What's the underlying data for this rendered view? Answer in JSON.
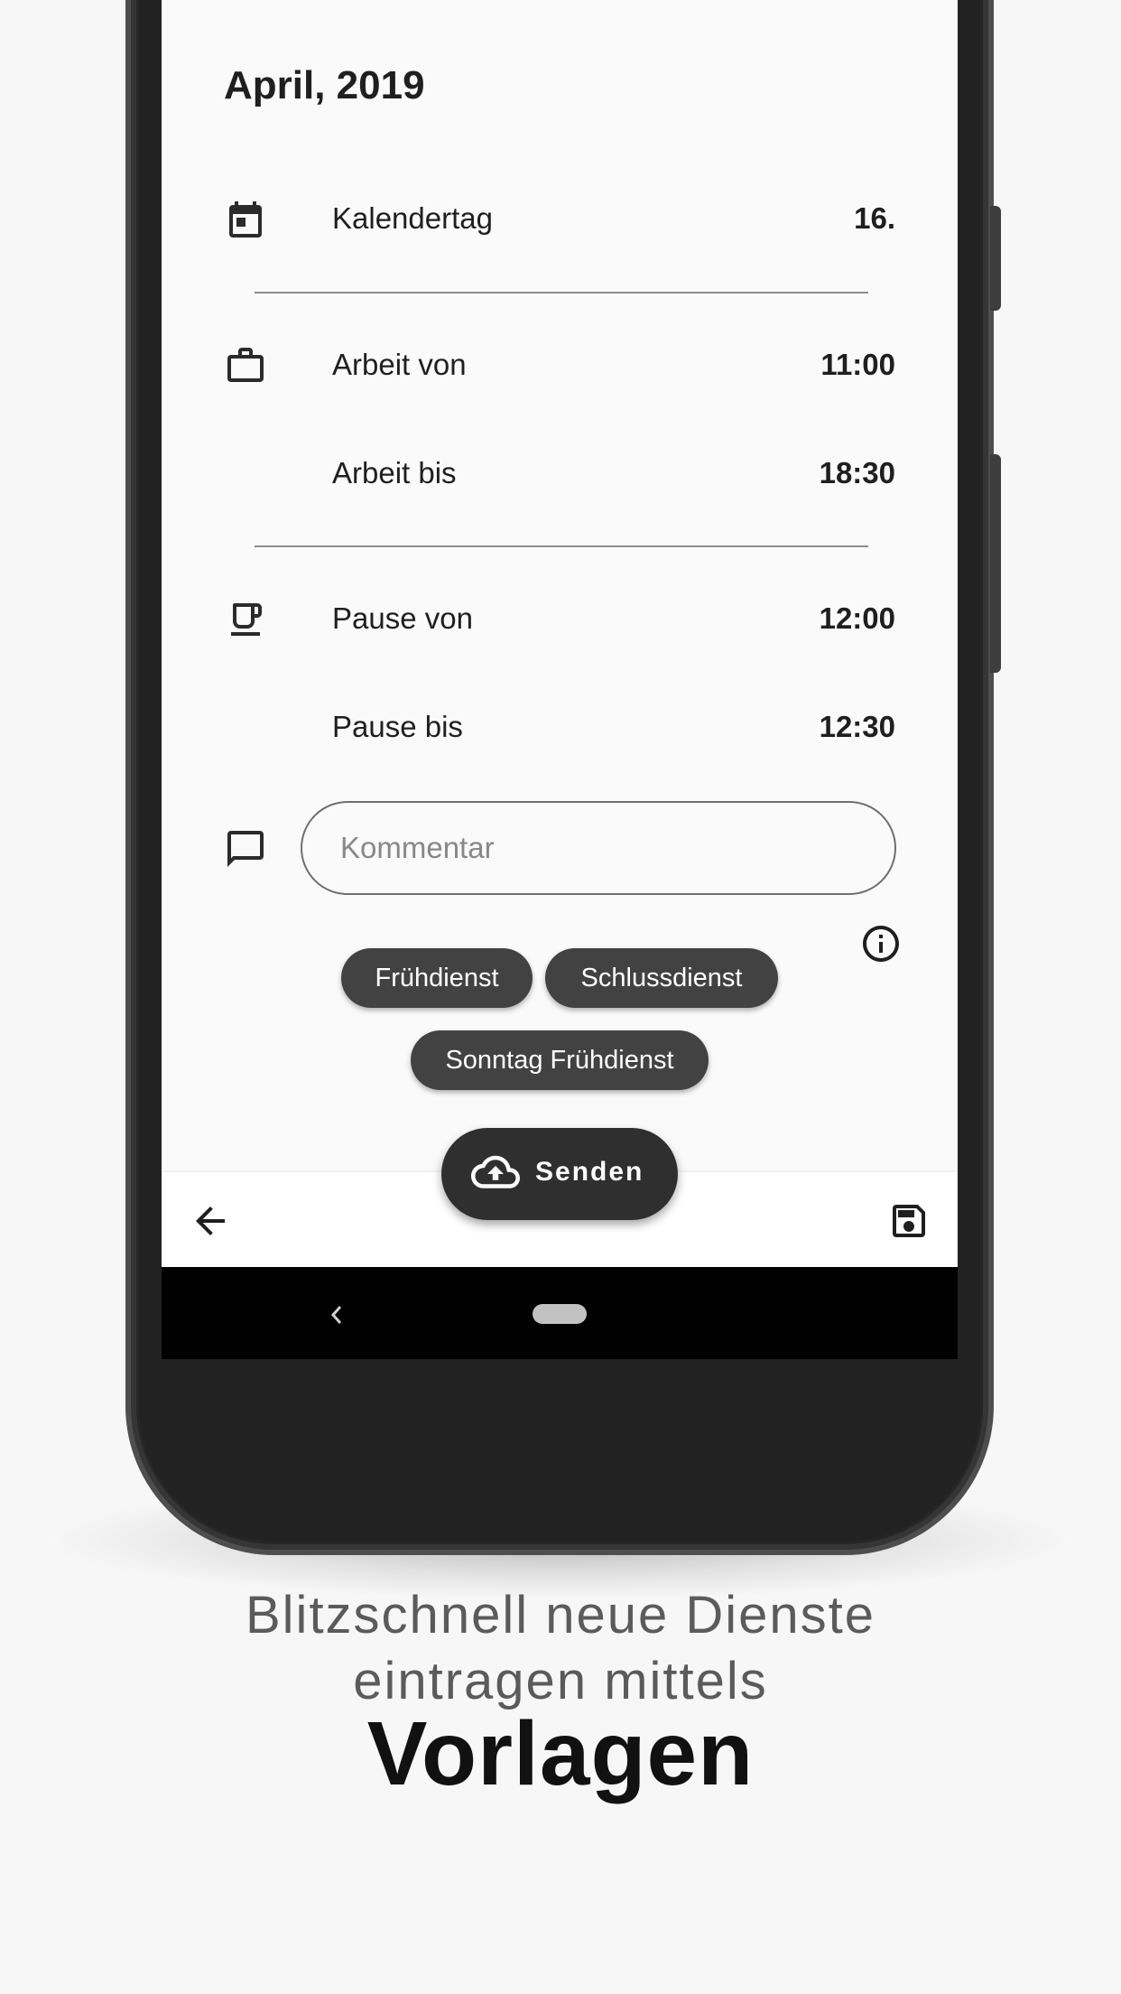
{
  "header": {
    "month": "April, 2019"
  },
  "rows": {
    "calendar_day": {
      "label": "Kalendertag",
      "value": "16."
    },
    "work_from": {
      "label": "Arbeit von",
      "value": "11:00"
    },
    "work_to": {
      "label": "Arbeit bis",
      "value": "18:30"
    },
    "break_from": {
      "label": "Pause von",
      "value": "12:00"
    },
    "break_to": {
      "label": "Pause bis",
      "value": "12:30"
    }
  },
  "comment": {
    "placeholder": "Kommentar",
    "value": ""
  },
  "templates": [
    "Frühdienst",
    "Schlussdienst",
    "Sonntag Frühdienst"
  ],
  "fab": {
    "label": "Senden",
    "icon": "cloud-upload-icon"
  },
  "icons": [
    "calendar-icon",
    "briefcase-icon",
    "coffee-icon",
    "comment-icon",
    "info-icon",
    "back-arrow-icon",
    "save-icon"
  ],
  "caption": {
    "line1": "Blitzschnell neue Dienste",
    "line2": "eintragen mittels",
    "emphasis": "Vorlagen"
  },
  "colors": {
    "chip": "#424242",
    "fab": "#2f2f2f",
    "screen_bg": "#fafafa"
  }
}
